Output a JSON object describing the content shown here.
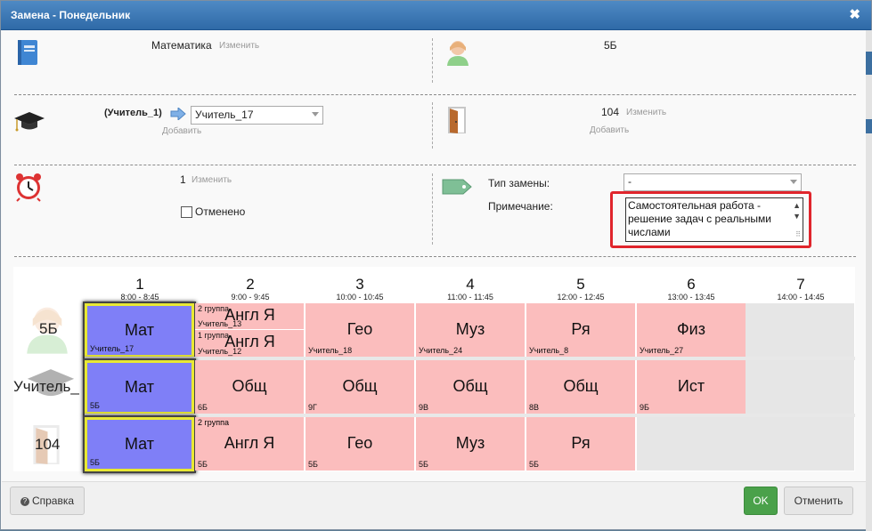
{
  "window": {
    "title": "Замена - Понедельник"
  },
  "subject": {
    "value": "Математика",
    "change_link": "Изменить"
  },
  "class_field": {
    "value": "5Б"
  },
  "teacher": {
    "old": "(Учитель_1)",
    "selected": "Учитель_17",
    "add_link": "Добавить"
  },
  "room": {
    "value": "104",
    "change_link": "Изменить",
    "add_link": "Добавить"
  },
  "lesson": {
    "number": "1",
    "change_link": "Изменить",
    "cancelled_label": "Отменено"
  },
  "replacement": {
    "type_label": "Тип замены:",
    "type_value": "-",
    "note_label": "Примечание:",
    "note_lines": [
      "Самостоятельная работа -",
      "решение задач с реальными",
      "числами"
    ]
  },
  "grid": {
    "columns": [
      {
        "n": "1",
        "time": "8:00 - 8:45"
      },
      {
        "n": "2",
        "time": "9:00 - 9:45"
      },
      {
        "n": "3",
        "time": "10:00 - 10:45"
      },
      {
        "n": "4",
        "time": "11:00 - 11:45"
      },
      {
        "n": "5",
        "time": "12:00 - 12:45"
      },
      {
        "n": "6",
        "time": "13:00 - 13:45"
      },
      {
        "n": "7",
        "time": "14:00 - 14:45"
      }
    ],
    "row_labels": {
      "class": "5Б",
      "teacher": "Учитель_",
      "room": "104"
    },
    "class_row": {
      "c1": {
        "subj": "Мат",
        "sub": "Учитель_17"
      },
      "c2_top": {
        "grp": "2 группа",
        "subj": "Англ Я",
        "sub": "Учитель_13"
      },
      "c2_bot": {
        "grp": "1 группа",
        "subj": "Англ Я",
        "sub": "Учитель_12"
      },
      "c3": {
        "subj": "Гео",
        "sub": "Учитель_18"
      },
      "c4": {
        "subj": "Муз",
        "sub": "Учитель_24"
      },
      "c5": {
        "subj": "Ря",
        "sub": "Учитель_8"
      },
      "c6": {
        "subj": "Физ",
        "sub": "Учитель_27"
      }
    },
    "teacher_row": {
      "c1": {
        "subj": "Мат",
        "sub": "5Б"
      },
      "c2": {
        "subj": "Общ",
        "sub": "6Б"
      },
      "c3": {
        "subj": "Общ",
        "sub": "9Г"
      },
      "c4": {
        "subj": "Общ",
        "sub": "9В"
      },
      "c5": {
        "subj": "Общ",
        "sub": "8В"
      },
      "c6": {
        "subj": "Ист",
        "sub": "9Б"
      }
    },
    "room_row": {
      "c1": {
        "subj": "Мат",
        "sub": "5Б"
      },
      "c2": {
        "grp": "2 группа",
        "subj": "Англ Я",
        "sub": "5Б"
      },
      "c3": {
        "subj": "Гео",
        "sub": "5Б"
      },
      "c4": {
        "subj": "Муз",
        "sub": "5Б"
      },
      "c5": {
        "subj": "Ря",
        "sub": "5Б"
      }
    }
  },
  "footer": {
    "help": "Справка",
    "ok": "OK",
    "cancel": "Отменить"
  }
}
